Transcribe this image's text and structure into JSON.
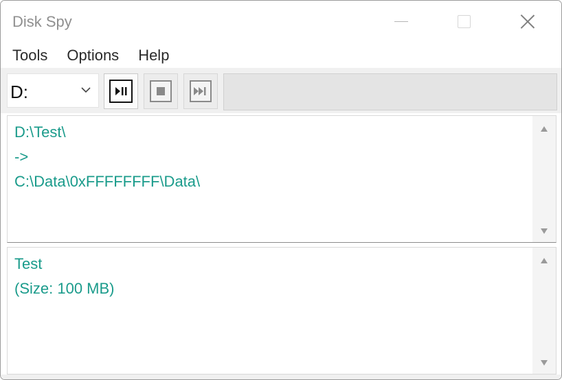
{
  "window": {
    "title": "Disk Spy"
  },
  "menu": {
    "items": [
      "Tools",
      "Options",
      "Help"
    ]
  },
  "toolbar": {
    "drive": {
      "selected": "D:"
    },
    "buttons": [
      {
        "icon": "play-pause-icon"
      },
      {
        "icon": "stop-icon"
      },
      {
        "icon": "skip-forward-icon"
      }
    ]
  },
  "top_panel": {
    "lines": [
      "D:\\Test\\",
      "->",
      "C:\\Data\\0xFFFFFFFF\\Data\\"
    ]
  },
  "bottom_panel": {
    "lines": [
      "Test",
      "(Size: 100 MB)"
    ]
  },
  "colors": {
    "text_accent": "#1a9b8b",
    "title_gray": "#8f8f8f",
    "toolbar_bg": "#f0f0f0"
  }
}
